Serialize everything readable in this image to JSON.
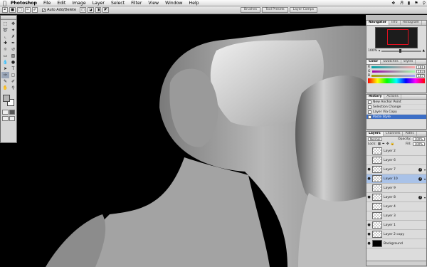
{
  "menubar": {
    "apple_icon": "apple-logo-icon",
    "app_name": "Photoshop",
    "menus": [
      "File",
      "Edit",
      "Image",
      "Layer",
      "Select",
      "Filter",
      "View",
      "Window",
      "Help"
    ]
  },
  "options_bar": {
    "auto_add_delete_label": "Auto Add/Delete",
    "auto_add_delete_checked": true
  },
  "palette_well": {
    "tabs": [
      "Brushes",
      "Tool Presets",
      "Layer Comps"
    ]
  },
  "navigator": {
    "tabs": [
      "Navigator",
      "Info",
      "Histogram"
    ],
    "zoom": "100%"
  },
  "color": {
    "tabs": [
      "Color",
      "Swatches",
      "Styles"
    ],
    "rows": [
      {
        "label": "R",
        "value": "161"
      },
      {
        "label": "G",
        "value": "163"
      },
      {
        "label": "B",
        "value": "167"
      }
    ]
  },
  "history": {
    "tabs": [
      "History",
      "Actions"
    ],
    "items": [
      {
        "label": "New Anchor Point"
      },
      {
        "label": "Selection Change"
      },
      {
        "label": "Layer Via Copy"
      },
      {
        "label": "Paste Style",
        "selected": true
      }
    ]
  },
  "layers": {
    "tabs": [
      "Layers",
      "Channels",
      "Paths"
    ],
    "blend_mode": "Normal",
    "opacity_label": "Opacity:",
    "opacity": "100%",
    "lock_label": "Lock:",
    "fill_label": "Fill:",
    "fill": "100%",
    "items": [
      {
        "name": "Layer 2",
        "visible": false,
        "fx": false
      },
      {
        "name": "Layer 6",
        "visible": false,
        "fx": false
      },
      {
        "name": "Layer 7",
        "visible": true,
        "fx": true
      },
      {
        "name": "Layer 10",
        "visible": true,
        "fx": true,
        "selected": true
      },
      {
        "name": "Layer 9",
        "visible": false,
        "fx": false
      },
      {
        "name": "Layer 8",
        "visible": true,
        "fx": true
      },
      {
        "name": "Layer 4",
        "visible": false,
        "fx": false
      },
      {
        "name": "Layer 3",
        "visible": false,
        "fx": false
      },
      {
        "name": "Layer 1",
        "visible": true,
        "fx": false
      },
      {
        "name": "Layer 2 copy",
        "visible": true,
        "fx": false
      },
      {
        "name": "Background",
        "visible": true,
        "fx": false,
        "black": true
      }
    ]
  },
  "colors": {
    "selection_blue": "#3d6fc6",
    "foreground_swatch": "#b4b4b4",
    "background_swatch": "#ffffff"
  }
}
